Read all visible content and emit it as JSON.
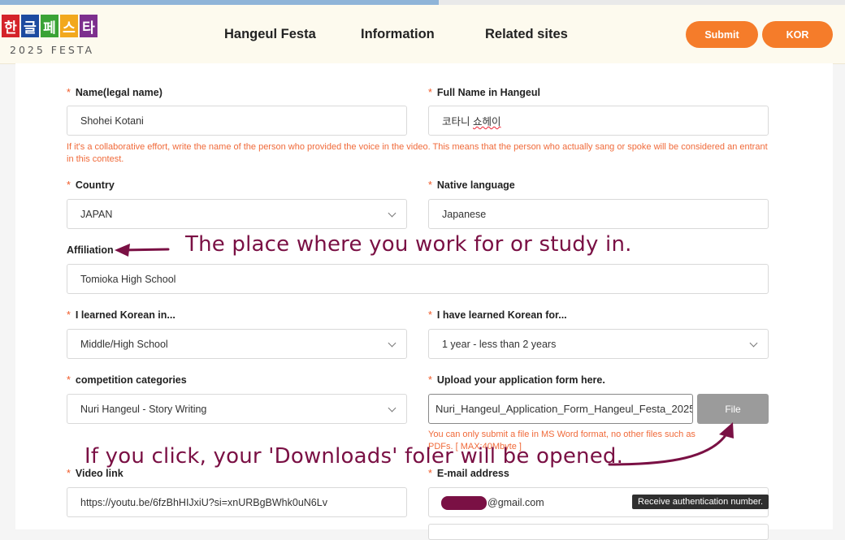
{
  "logo": {
    "chars": [
      "한",
      "글",
      "페",
      "스",
      "타"
    ],
    "colors": [
      "#d4232a",
      "#1d4ba0",
      "#3aa336",
      "#f2a81d",
      "#7d2f8e"
    ],
    "year_text": "2025 FESTA"
  },
  "nav": {
    "items": [
      "Hangeul Festa",
      "Information",
      "Related sites"
    ]
  },
  "header_buttons": {
    "submit": "Submit",
    "lang": "KOR"
  },
  "form": {
    "required_mark": "*",
    "name_label": "Name(legal name)",
    "name_value": "Shohei Kotani",
    "hangeul_label": "Full Name in Hangeul",
    "hangeul_value_a": "코타니 ",
    "hangeul_value_b": "쇼헤이",
    "collab_help": "If it's a collaborative effort, write the name of the person who provided the voice in the video. This means that the person who actually sang or spoke will be considered an entrant in this contest.",
    "country_label": "Country",
    "country_value": "JAPAN",
    "native_label": "Native language",
    "native_value": "Japanese",
    "affiliation_label": "Affiliation",
    "affiliation_value": "Tomioka High School",
    "learned_in_label": "I learned Korean in...",
    "learned_in_value": "Middle/High School",
    "learned_for_label": "I have learned Korean for...",
    "learned_for_value": "1 year - less than 2 years",
    "category_label": "competition categories",
    "category_value": "Nuri Hangeul - Story Writing",
    "upload_label": "Upload your application form here.",
    "upload_value": "Nuri_Hangeul_Application_Form_Hangeul_Festa_2025",
    "file_button": "File",
    "upload_help": "You can only submit a file in MS Word format, no other files such as PDFs. [ MAX:40Mbyte ]",
    "video_label": "Video link",
    "video_value": "https://youtu.be/6fzBhHIJxiU?si=xnURBgBWhk0uN6Lv",
    "email_label": "E-mail address",
    "email_suffix": "@gmail.com",
    "auth_tooltip": "Receive authentication number."
  },
  "annotations": {
    "affiliation_note": "The place where you work for or study in.",
    "file_note": "If you click, your 'Downloads' foler will be opened."
  }
}
